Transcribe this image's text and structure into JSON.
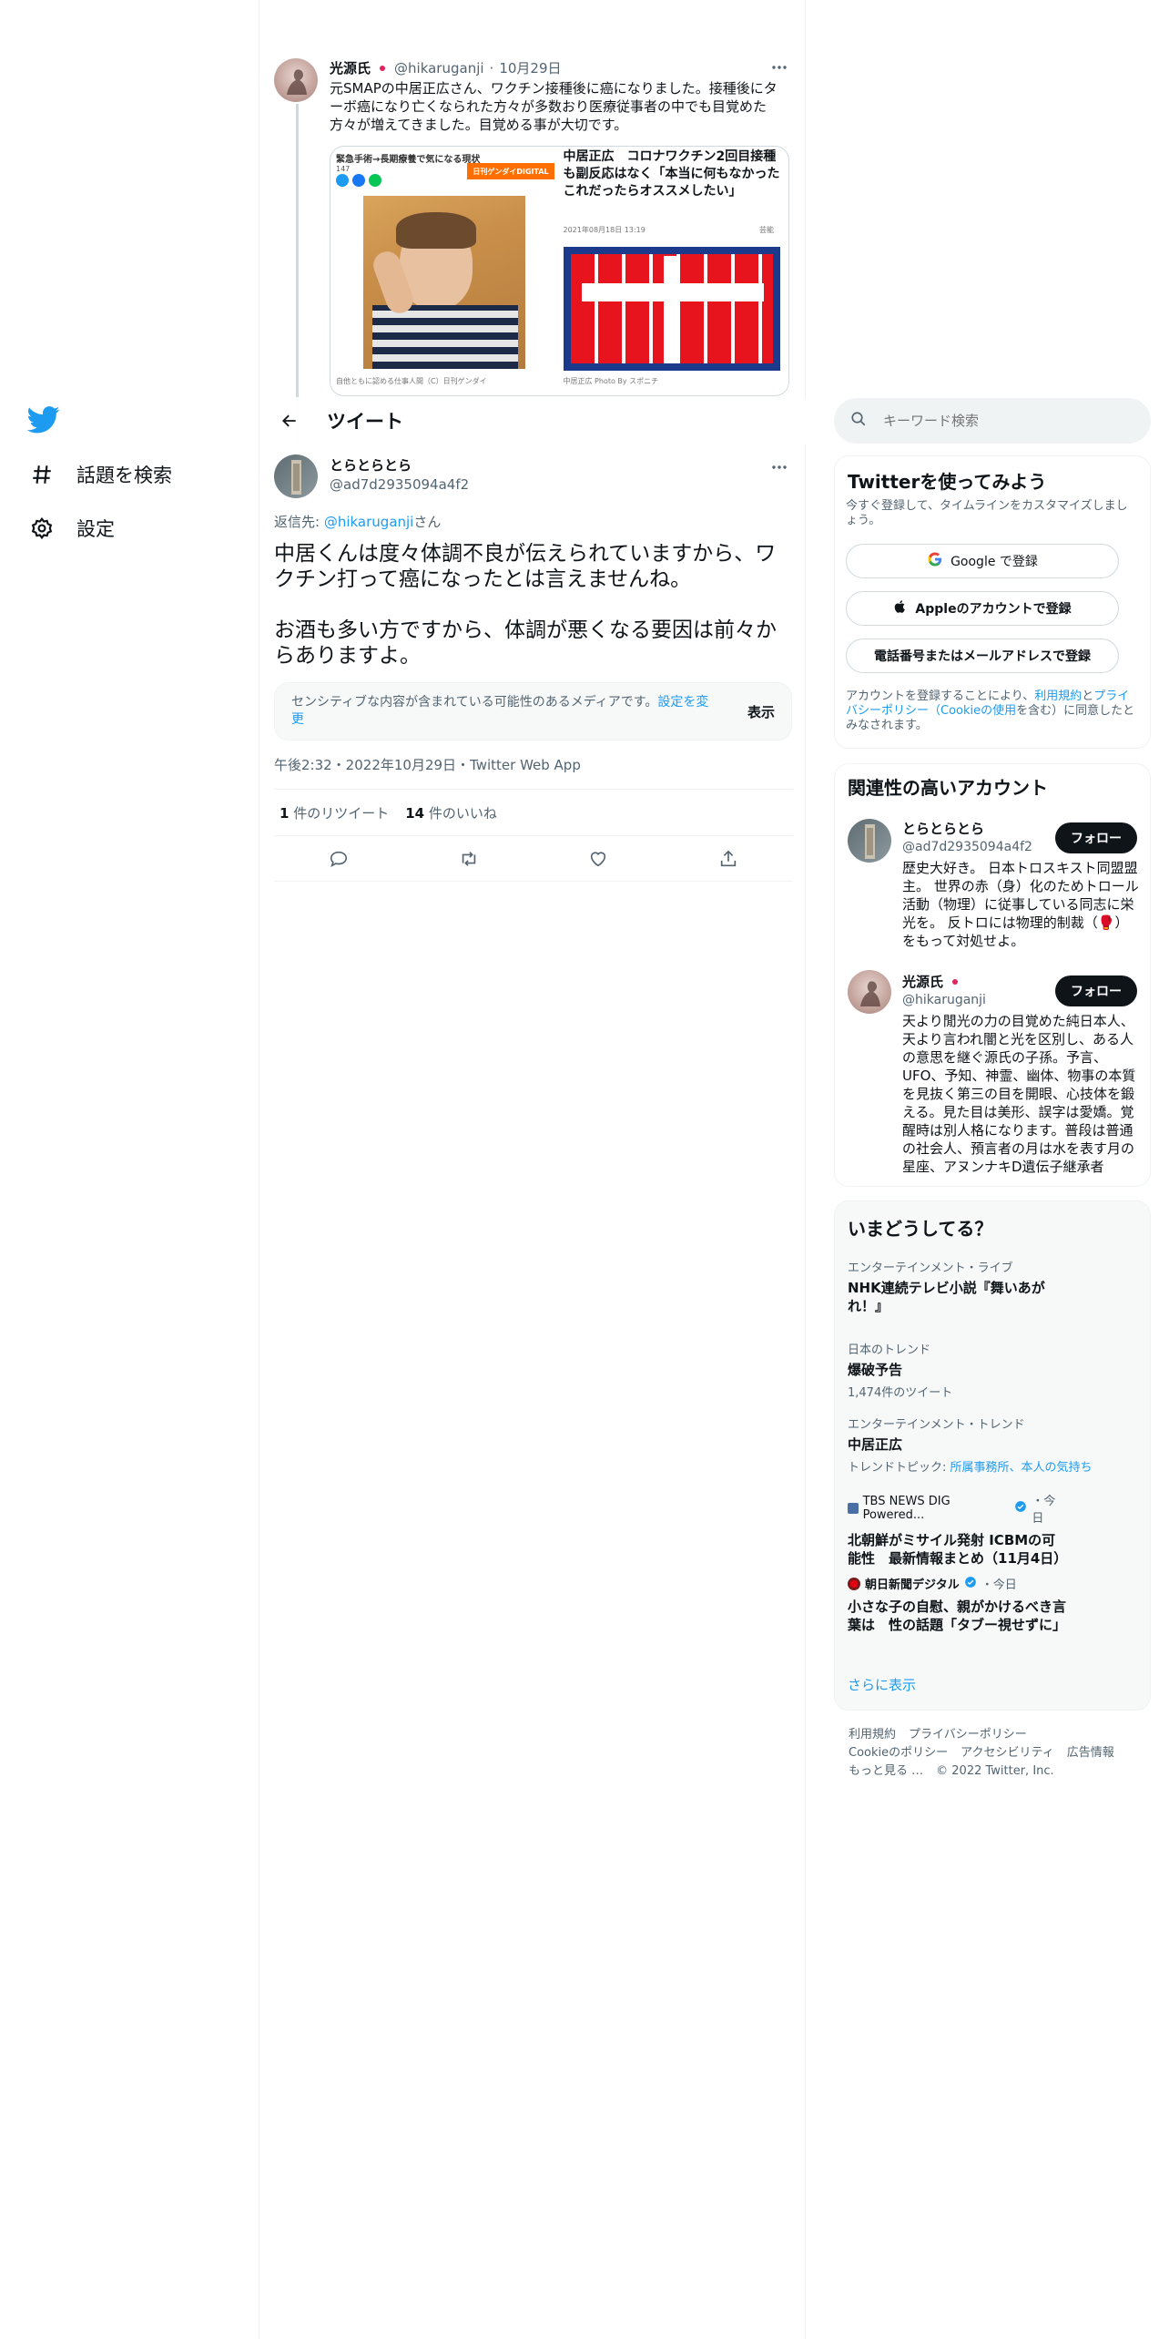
{
  "nav": {
    "logo_icon": "twitter-bird-icon",
    "items": [
      {
        "label": "話題を検索",
        "icon": "hashtag-icon"
      },
      {
        "label": "設定",
        "icon": "gear-icon"
      }
    ]
  },
  "parent_tweet": {
    "name": "光源氏",
    "handle": "@hikaruganji",
    "dot": "·",
    "date": "10月29日",
    "text": "元SMAPの中居正広さん、ワクチン接種後に癌になりました。接種後にターボ癌になり亡くなられた方々が多数おり医療従事者の中でも目覚めた方々が増えてきました。目覚める事が大切です。",
    "media_left": {
      "headline": "緊急手術→長期療養で気になる現状",
      "counts": "147",
      "brand": "日刊ゲンダイDIGITAL",
      "caption": "自他ともに認める仕事人間（C）日刊ゲンダイ"
    },
    "media_right": {
      "headline": "中居正広　コロナワクチン2回目接種も副反応はなく「本当に何もなかった　これだったらオススメしたい」",
      "date": "2021年08月18日 13:19",
      "tag": "芸能",
      "caption": "中居正広 Photo By スポニチ"
    }
  },
  "header": {
    "title": "ツイート"
  },
  "main_tweet": {
    "name": "とらとらとら",
    "handle": "@ad7d2935094a4f2",
    "reply_prefix": "返信先: ",
    "reply_handle": "@hikaruganji",
    "reply_suffix": "さん",
    "text_p1": "中居くんは度々体調不良が伝えられていますから、ワクチン打って癌になったとは言えませんね。",
    "text_p2": "お酒も多い方ですから、体調が悪くなる要因は前々からありますよ。",
    "sensitive_text": "センシティブな内容が含まれている可能性のあるメディアです。",
    "sensitive_link": "設定を変更",
    "show_label": "表示",
    "meta": "午後2:32・2022年10月29日・Twitter Web App",
    "retweets": "1",
    "retweets_label": "件のリツイート",
    "likes": "14",
    "likes_label": "件のいいね"
  },
  "search": {
    "placeholder": "キーワード検索"
  },
  "signup": {
    "title": "Twitterを使ってみよう",
    "subtitle": "今すぐ登録して、タイムラインをカスタマイズしましょう。",
    "google": "Google で登録",
    "apple": "Appleのアカウントで登録",
    "phone": "電話番号またはメールアドレスで登録",
    "legal_1": "アカウントを登録することにより、",
    "legal_terms": "利用規約",
    "legal_2": "と",
    "legal_privacy": "プライバシーポリシー",
    "legal_3": "（",
    "legal_cookie": "Cookieの使用",
    "legal_4": "を含む）に同意したとみなされます。"
  },
  "related": {
    "title": "関連性の高いアカウント",
    "follow_label": "フォロー",
    "accounts": [
      {
        "name": "とらとらとら",
        "handle": "@ad7d2935094a4f2",
        "bio": "歴史大好き。 日本トロスキスト同盟盟主。 世界の赤（身）化のためトロール活動（物理）に従事している同志に栄光を。 反トロには物理的制裁（🥊）をもって対処せよ。"
      },
      {
        "name": "光源氏",
        "handle": "@hikaruganji",
        "bio": "天より閒光の力の目覚めた純日本人、天より言われ闇と光を区別し、ある人の意思を継ぐ源氏の子孫。予言、UFO、予知、神霊、幽体、物事の本質を見抜く第三の目を開眼、心技体を鍛える。見た目は美形、誤字は愛嬌。覚醒時は別人格になります。普段は普通の社会人、預言者の月は水を表す月の星座、アヌンナキD遺伝子継承者"
      }
    ]
  },
  "trends": {
    "title": "いまどうしてる？",
    "items": [
      {
        "meta": "エンターテインメント・ライブ",
        "title": "NHK連続テレビ小説『舞いあがれ！』",
        "sub": ""
      },
      {
        "meta": "日本のトレンド",
        "title": "爆破予告",
        "sub": "1,474件のツイート"
      },
      {
        "meta": "エンターテインメント・トレンド",
        "title": "中居正広",
        "sub_prefix": "トレンドトピック: ",
        "sub_links": "所属事務所、本人の気持ち"
      },
      {
        "source": "TBS NEWS DIG Powered...",
        "time": "・今日",
        "title": "北朝鮮がミサイル発射 ICBMの可能性　最新情報まとめ（11月4日）"
      },
      {
        "source": "朝日新聞デジタル",
        "time": "・今日",
        "title": "小さな子の自慰、親がかけるべき言葉は　性の話題「タブー視せずに」"
      }
    ],
    "more": "さらに表示"
  },
  "footer": {
    "links": [
      "利用規約",
      "プライバシーポリシー",
      "Cookieのポリシー",
      "アクセシビリティ",
      "広告情報",
      "もっと見る …"
    ],
    "copyright": "© 2022 Twitter, Inc."
  },
  "colors": {
    "accent": "#1d9bf0",
    "text": "#0f1419",
    "muted": "#536471",
    "border": "#eff3f4"
  }
}
